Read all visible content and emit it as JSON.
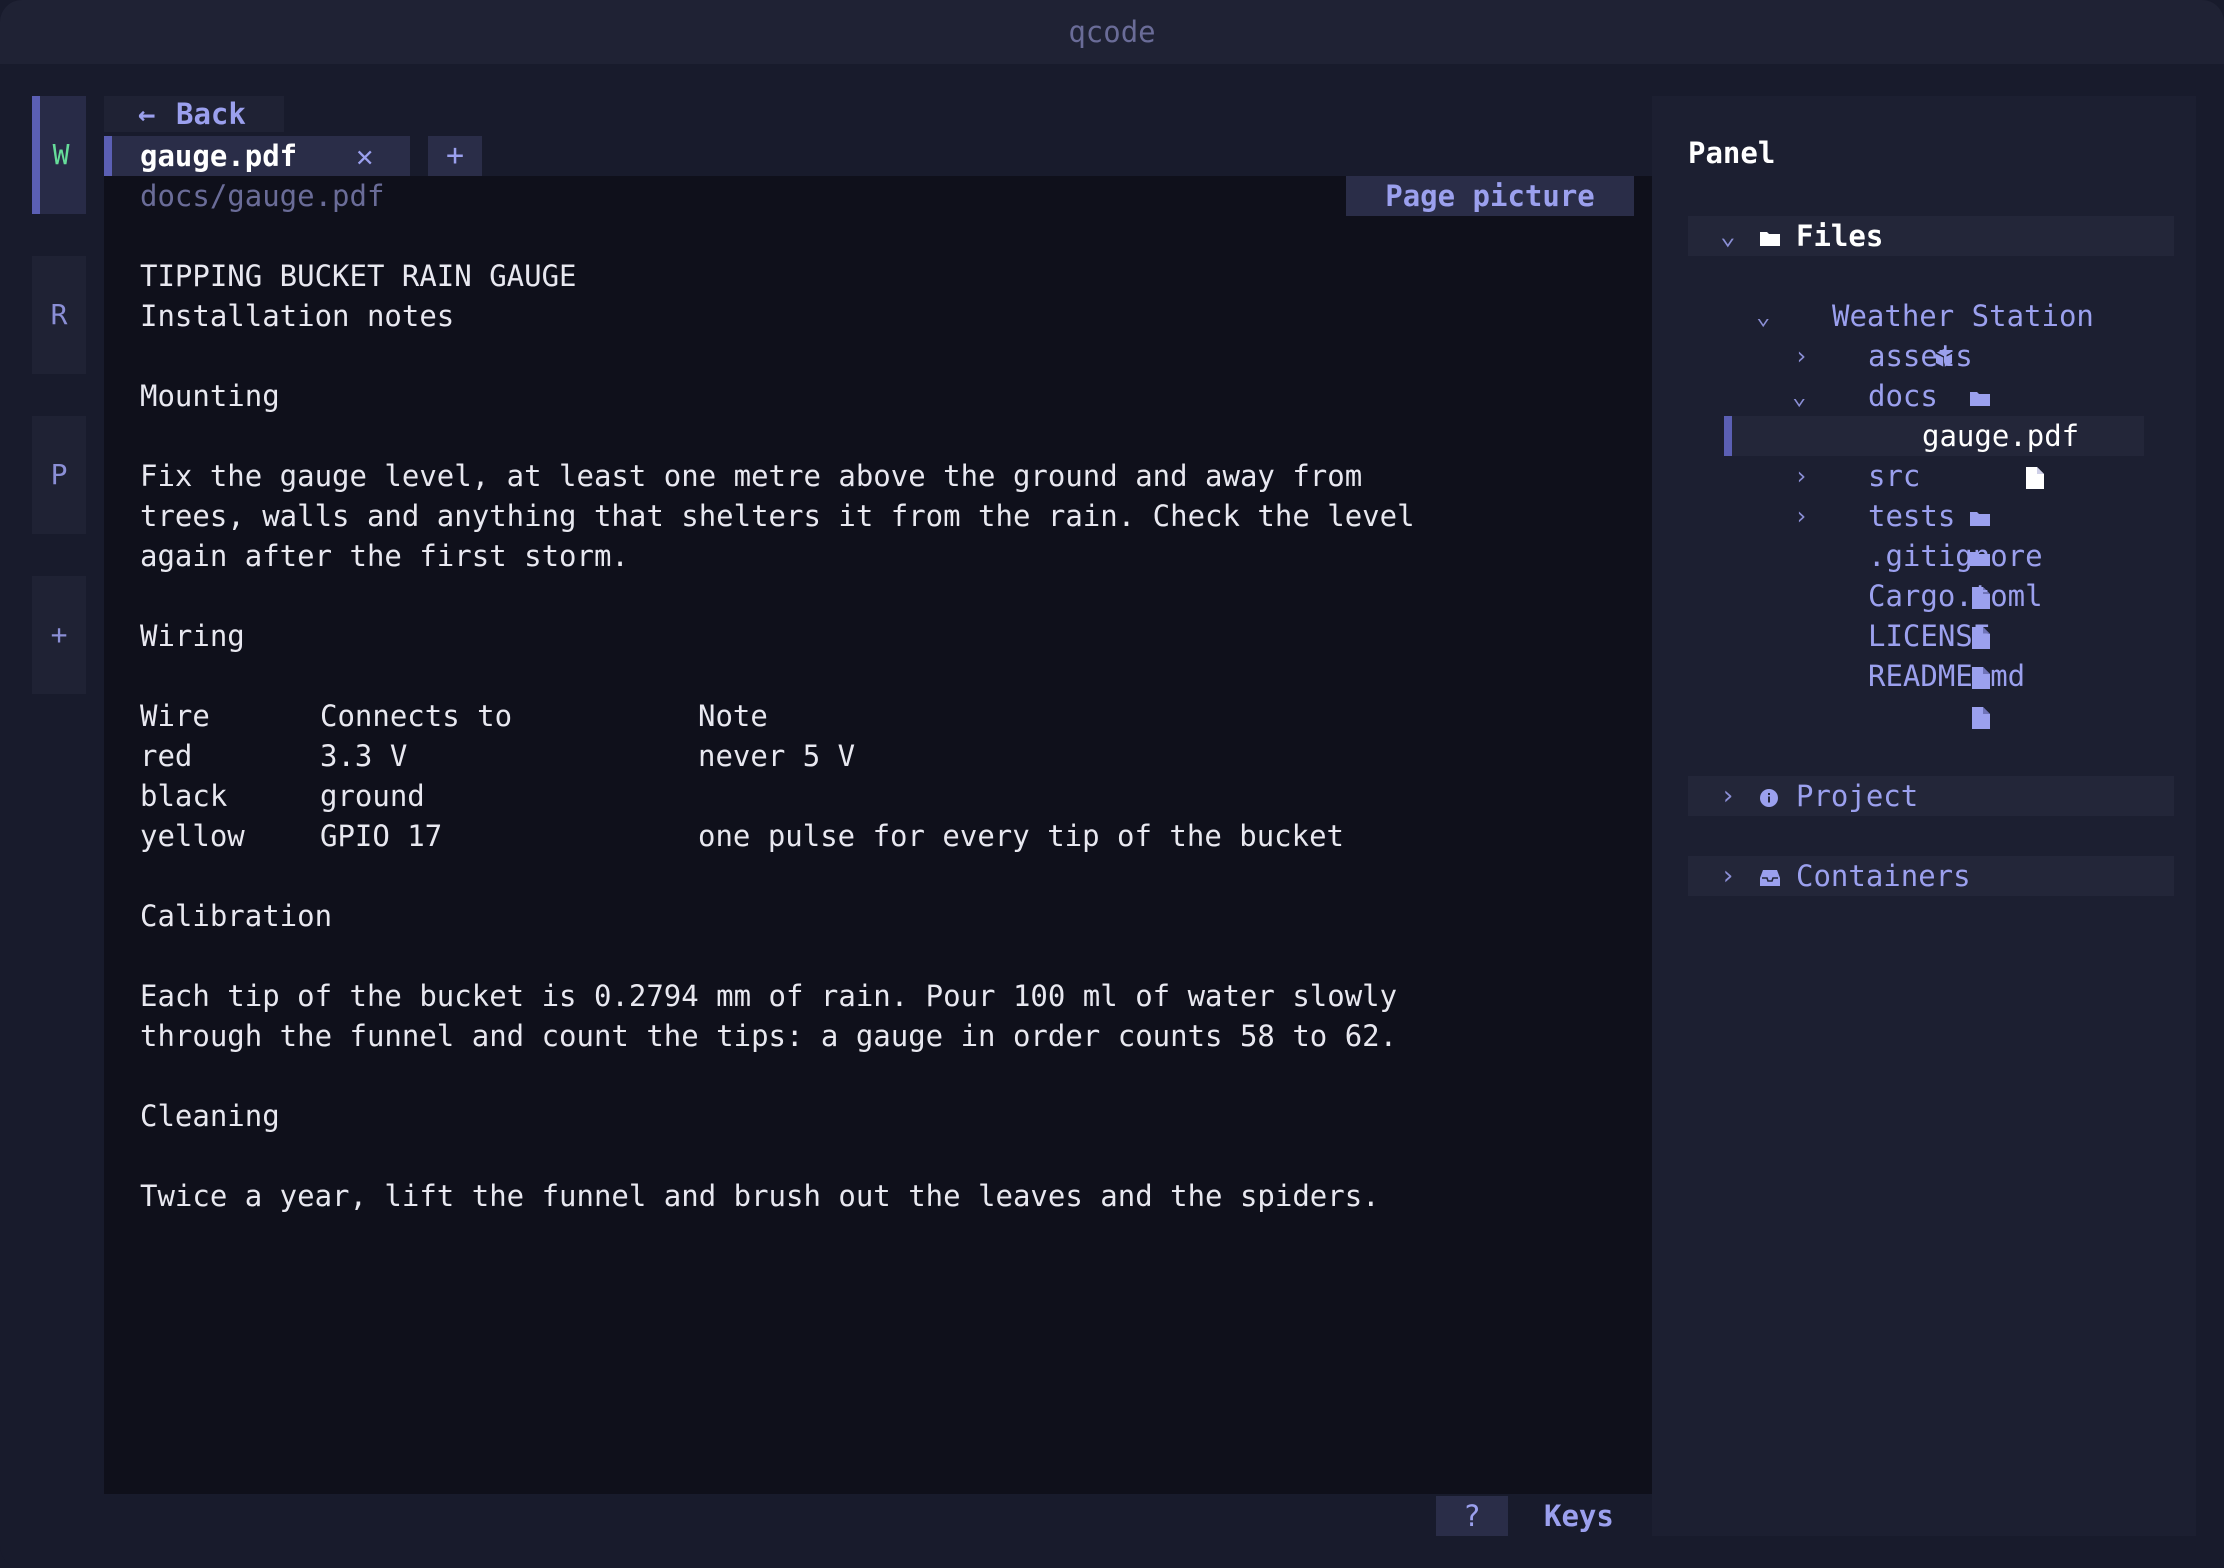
{
  "app": {
    "title": "qcode"
  },
  "rail": {
    "items": [
      {
        "label": "W",
        "active": true
      },
      {
        "label": "R"
      },
      {
        "label": "P"
      },
      {
        "label": "+"
      }
    ]
  },
  "tabs": {
    "back_label": "Back",
    "items": [
      {
        "label": "gauge.pdf"
      }
    ],
    "add_label": "+"
  },
  "editor": {
    "breadcrumb": "docs/gauge.pdf",
    "page_picture_label": "Page picture",
    "doc": {
      "title": "TIPPING BUCKET RAIN GAUGE",
      "subtitle": "Installation notes",
      "mounting_heading": "Mounting",
      "mounting_lines": [
        "Fix the gauge level, at least one metre above the ground and away from",
        "trees, walls and anything that shelters it from the rain. Check the level",
        "again after the first storm."
      ],
      "wiring_heading": "Wiring",
      "wiring_table": {
        "headers": [
          "Wire",
          "Connects to",
          "Note"
        ],
        "rows": [
          [
            "red",
            "3.3 V",
            "never 5 V"
          ],
          [
            "black",
            "ground",
            ""
          ],
          [
            "yellow",
            "GPIO 17",
            "one pulse for every tip of the bucket"
          ]
        ]
      },
      "calibration_heading": "Calibration",
      "calibration_lines": [
        "Each tip of the bucket is 0.2794 mm of rain. Pour 100 ml of water slowly",
        "through the funnel and count the tips: a gauge in order counts 58 to 62."
      ],
      "cleaning_heading": "Cleaning",
      "cleaning_lines": [
        "Twice a year, lift the funnel and brush out the leaves and the spiders."
      ]
    }
  },
  "statusbar": {
    "help_label": "?",
    "keys_label": "Keys"
  },
  "panel": {
    "title": "Panel",
    "sections": {
      "files": {
        "label": "Files",
        "expanded": true
      },
      "project": {
        "label": "Project",
        "expanded": false
      },
      "containers": {
        "label": "Containers",
        "expanded": false
      }
    },
    "tree": {
      "root": "Weather Station",
      "items": [
        {
          "label": "assets",
          "type": "folder",
          "expanded": false
        },
        {
          "label": "docs",
          "type": "folder",
          "expanded": true
        },
        {
          "label": "gauge.pdf",
          "type": "file",
          "selected": true
        },
        {
          "label": "src",
          "type": "folder",
          "expanded": false
        },
        {
          "label": "tests",
          "type": "folder",
          "expanded": false
        },
        {
          "label": ".gitignore",
          "type": "file"
        },
        {
          "label": "Cargo.toml",
          "type": "file"
        },
        {
          "label": "LICENSE",
          "type": "file"
        },
        {
          "label": "README.md",
          "type": "file"
        }
      ]
    }
  },
  "colors": {
    "background": "#181b2c",
    "editor_bg": "#0f101b",
    "accent": "#9ba0ee",
    "accent_bar": "#5b5fb4",
    "active_rail": "#66dd9a",
    "text": "#e8e8f0"
  }
}
